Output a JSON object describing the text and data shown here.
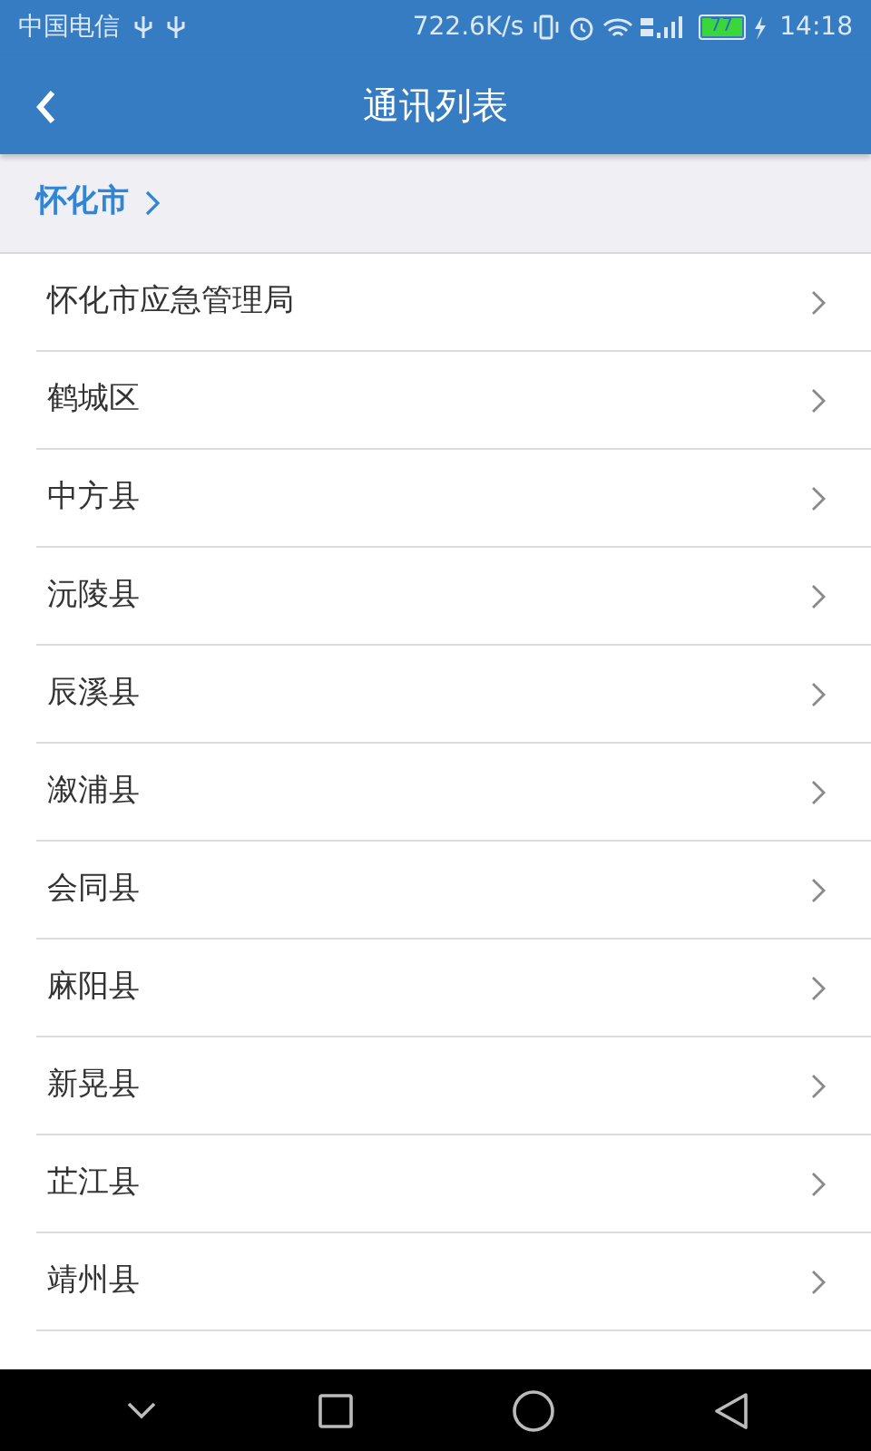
{
  "status_bar": {
    "carrier": "中国电信",
    "speed": "722.6K/s",
    "battery": "77",
    "time": "14:18"
  },
  "app_bar": {
    "title": "通讯列表"
  },
  "breadcrumb": {
    "label": "怀化市"
  },
  "items": [
    {
      "label": "怀化市应急管理局"
    },
    {
      "label": "鹤城区"
    },
    {
      "label": "中方县"
    },
    {
      "label": "沅陵县"
    },
    {
      "label": "辰溪县"
    },
    {
      "label": "溆浦县"
    },
    {
      "label": "会同县"
    },
    {
      "label": "麻阳县"
    },
    {
      "label": "新晃县"
    },
    {
      "label": "芷江县"
    },
    {
      "label": "靖州县"
    }
  ]
}
